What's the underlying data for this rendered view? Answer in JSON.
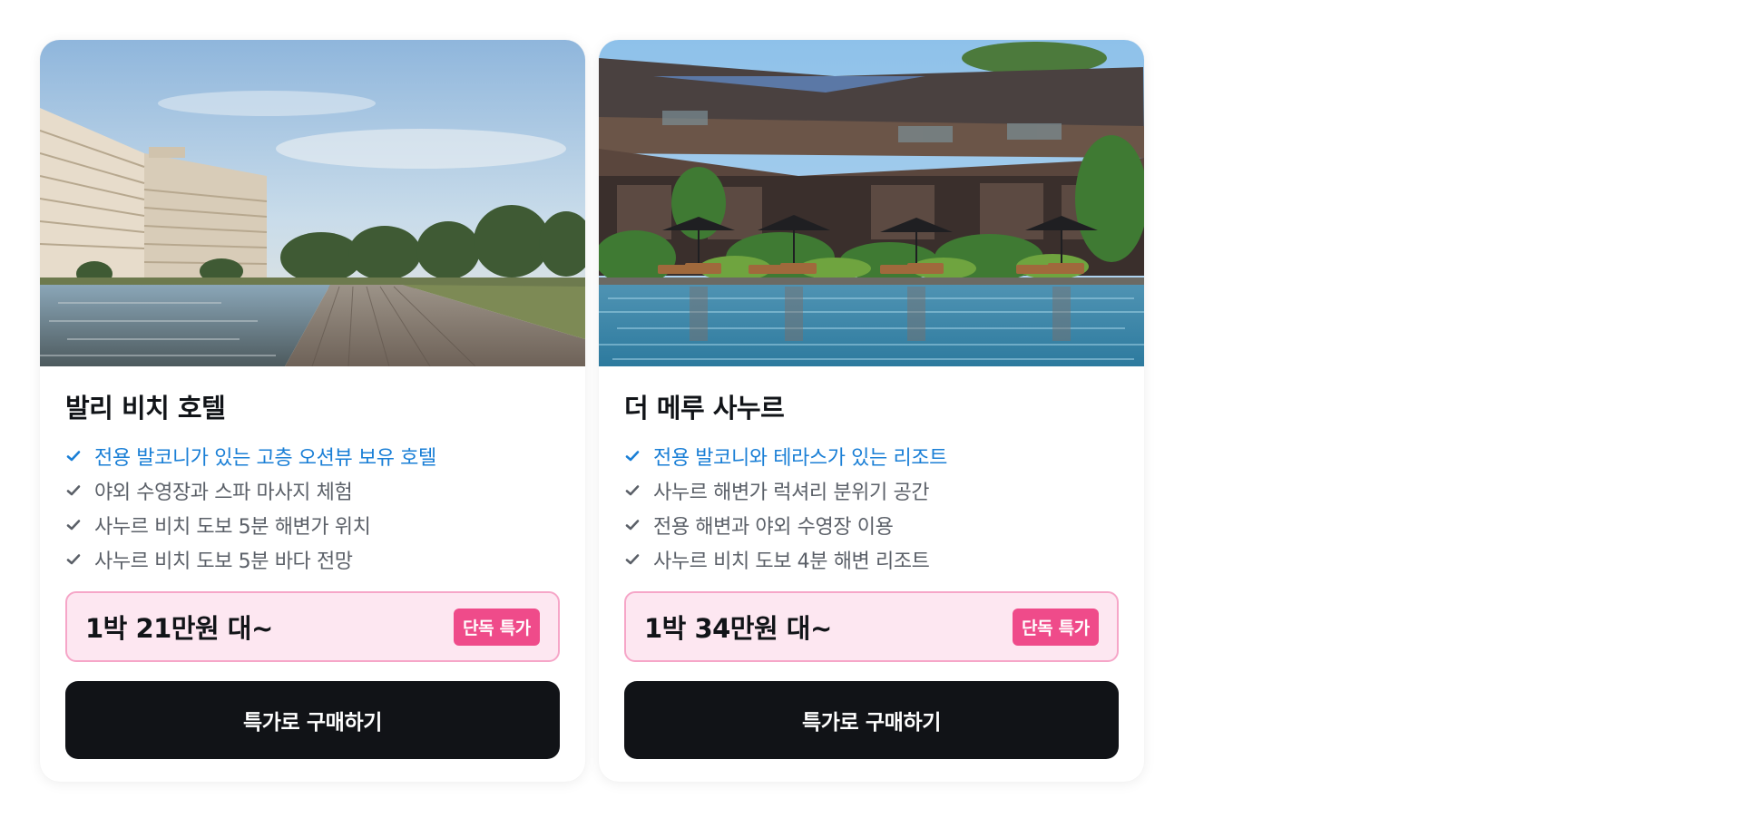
{
  "colors": {
    "highlight": "#1a7fd6",
    "badge": "#ef4b8a",
    "price_bg": "#fde7f1",
    "button": "#111317"
  },
  "cards": [
    {
      "image": "beach-hotel-photo",
      "title": "발리 비치 호텔",
      "features": [
        "전용 발코니가 있는 고층 오션뷰 보유 호텔",
        "야외 수영장과 스파 마사지 체험",
        "사누르 비치 도보 5분 해변가 위치",
        "사누르 비치 도보 5분 바다 전망"
      ],
      "price": "1박 21만원 대~",
      "badge": "단독 특가",
      "button": "특가로 구매하기"
    },
    {
      "image": "resort-pool-photo",
      "title": "더 메루 사누르",
      "features": [
        "전용 발코니와 테라스가 있는 리조트",
        "사누르 해변가 럭셔리 분위기 공간",
        "전용 해변과 야외 수영장 이용",
        "사누르 비치 도보 4분 해변 리조트"
      ],
      "price": "1박 34만원 대~",
      "badge": "단독 특가",
      "button": "특가로 구매하기"
    }
  ]
}
